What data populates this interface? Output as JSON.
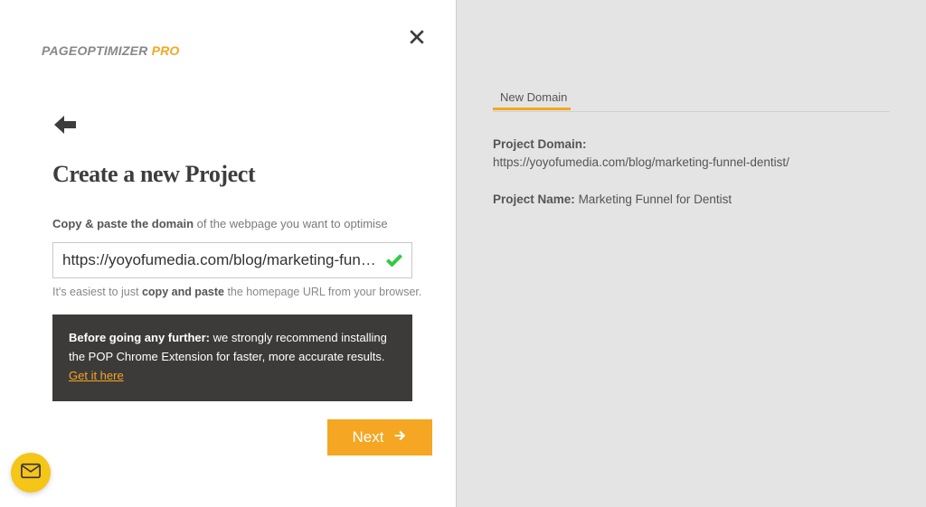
{
  "logo": {
    "part1": "PAGE",
    "part2": "OPTIMIZER ",
    "part3": "PRO"
  },
  "heading": "Create a new Project",
  "instr1": {
    "bold": "Copy & paste the domain",
    "rest": " of the webpage you want to optimise"
  },
  "url_field": {
    "value": "https://yoyofumedia.com/blog/marketing-funnel"
  },
  "instr2": {
    "pre": "It's easiest to just ",
    "bold": "copy and paste",
    "post": " the homepage URL from your browser."
  },
  "info_box": {
    "bold": "Before going any further:",
    "text": " we strongly recommend installing the POP Chrome Extension for faster, more accurate results. ",
    "link": "Get it here"
  },
  "next_button": "Next",
  "right": {
    "tab_label": "New Domain",
    "domain_label": "Project Domain:",
    "domain_value": "https://yoyofumedia.com/blog/marketing-funnel-dentist/",
    "name_label": "Project Name:",
    "name_value": "Marketing Funnel for Dentist"
  },
  "colors": {
    "accent": "#f5a623",
    "dark": "#3d3b39"
  }
}
